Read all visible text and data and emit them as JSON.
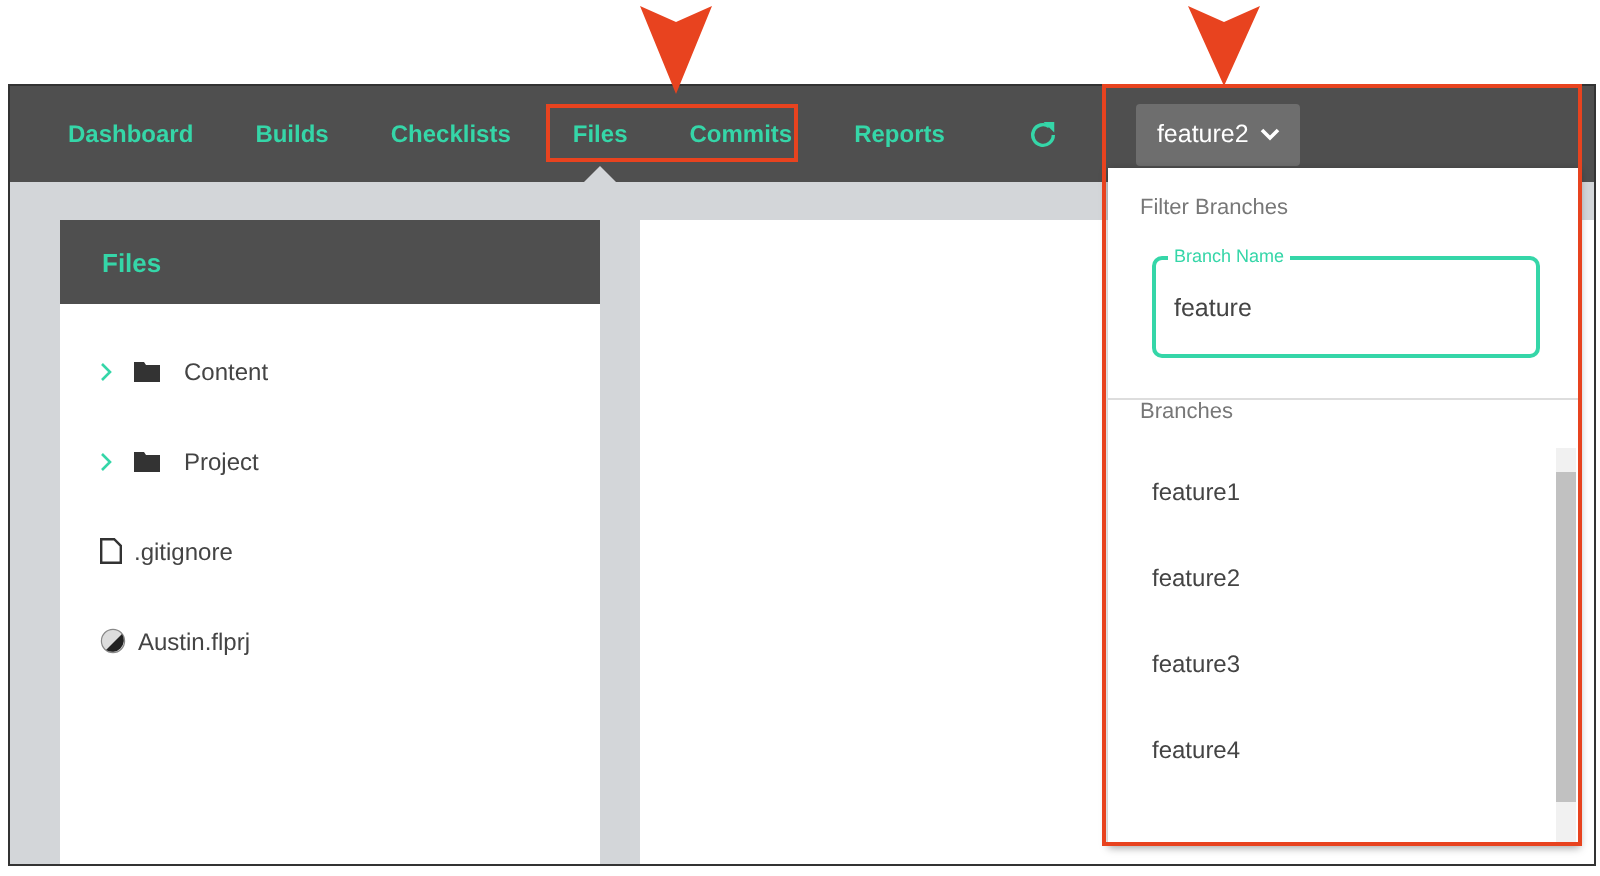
{
  "nav": {
    "tabs": [
      {
        "label": "Dashboard",
        "selected": false
      },
      {
        "label": "Builds",
        "selected": false
      },
      {
        "label": "Checklists",
        "selected": false
      },
      {
        "label": "Files",
        "selected": true
      },
      {
        "label": "Commits",
        "selected": false
      },
      {
        "label": "Reports",
        "selected": false
      }
    ],
    "branch_button": "feature2"
  },
  "files_panel": {
    "title": "Files",
    "items": [
      {
        "kind": "folder",
        "name": "Content",
        "expanded": false
      },
      {
        "kind": "folder",
        "name": "Project",
        "expanded": false
      },
      {
        "kind": "file",
        "name": ".gitignore"
      },
      {
        "kind": "project",
        "name": "Austin.flprj"
      }
    ]
  },
  "branch_menu": {
    "filter_heading": "Filter Branches",
    "field_label": "Branch Name",
    "field_value": "feature",
    "list_heading": "Branches",
    "branches": [
      "feature1",
      "feature2",
      "feature3",
      "feature4"
    ]
  }
}
